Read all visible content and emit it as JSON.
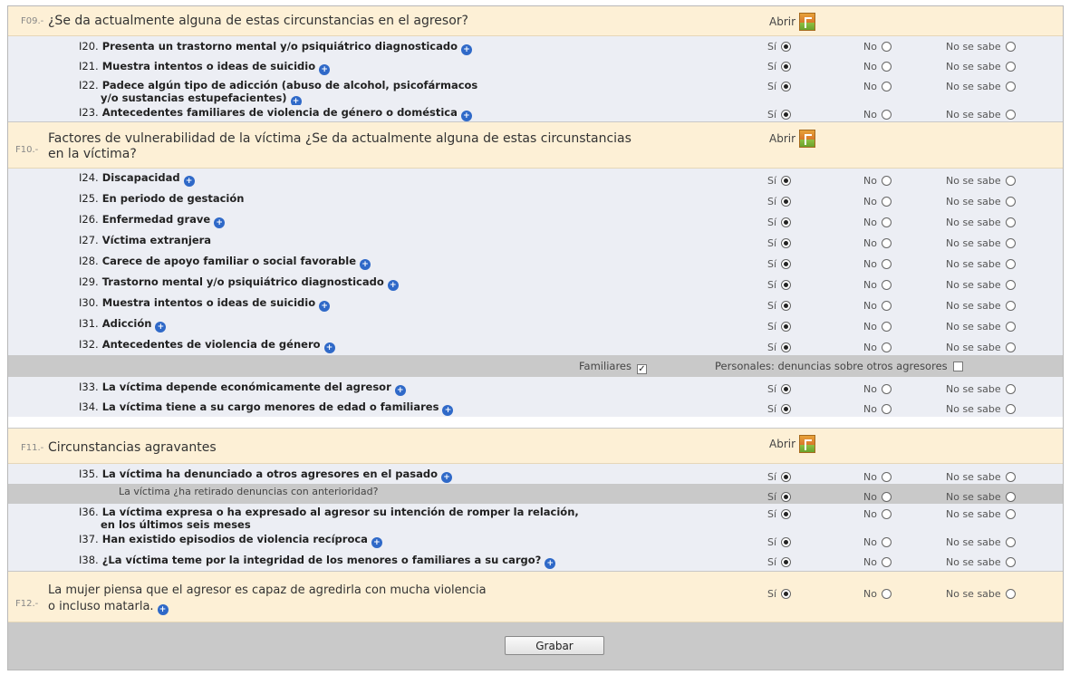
{
  "options": {
    "si": "Sí",
    "no": "No",
    "nose": "No se sabe"
  },
  "abrir": "Abrir",
  "sections": {
    "f09": {
      "code": "F09.-",
      "title": "¿Se da actualmente alguna de estas circunstancias en el agresor?",
      "items": [
        {
          "num": "I20.",
          "text": "Presenta un trastorno mental y/o psiquiátrico diagnosticado"
        },
        {
          "num": "I21.",
          "text": "Muestra intentos o ideas de suicidio"
        },
        {
          "num": "I22.",
          "text": "Padece algún tipo de adicción (abuso de alcohol, psicofármacos",
          "text2": "y/o sustancias estupefacientes)"
        },
        {
          "num": "I23.",
          "text": "Antecedentes familiares de violencia de género o doméstica"
        }
      ]
    },
    "f10": {
      "code": "F10.-",
      "title": "Factores de vulnerabilidad de la víctima ¿Se da actualmente alguna de estas circunstancias",
      "title2": "en la víctima?",
      "items": [
        {
          "num": "I24.",
          "text": "Discapacidad"
        },
        {
          "num": "I25.",
          "text": "En periodo de gestación"
        },
        {
          "num": "I26.",
          "text": "Enfermedad grave"
        },
        {
          "num": "I27.",
          "text": "Víctima extranjera"
        },
        {
          "num": "I28.",
          "text": "Carece de apoyo familiar o social favorable"
        },
        {
          "num": "I29.",
          "text": "Trastorno mental y/o psiquiátrico diagnosticado"
        },
        {
          "num": "I30.",
          "text": "Muestra intentos o ideas de suicidio"
        },
        {
          "num": "I31.",
          "text": "Adicción"
        },
        {
          "num": "I32.",
          "text": "Antecedentes de violencia de género"
        },
        {
          "num": "I33.",
          "text": "La víctima depende económicamente del agresor"
        },
        {
          "num": "I34.",
          "text": "La víctima tiene a su cargo menores de edad o familiares"
        }
      ],
      "familiares": "Familiares",
      "personales": "Personales: denuncias sobre otros agresores"
    },
    "f11": {
      "code": "F11.-",
      "title": "Circunstancias agravantes",
      "items": [
        {
          "num": "I35.",
          "text": "La víctima ha denunciado a otros agresores en el pasado"
        },
        {
          "sub": "La víctima ¿ha retirado denuncias con anterioridad?"
        },
        {
          "num": "I36.",
          "text": "La víctima expresa o ha expresado al agresor su intención de romper la relación,",
          "text2": "en los últimos seis meses"
        },
        {
          "num": "I37.",
          "text": "Han existido episodios de violencia recíproca"
        },
        {
          "num": "I38.",
          "text": "¿La víctima teme por la integridad de los menores o familiares a su cargo?"
        }
      ]
    },
    "f12": {
      "code": "F12.-",
      "title": "La mujer piensa que el agresor es capaz de agredirla con mucha violencia",
      "title2": "o incluso matarla."
    }
  },
  "save_label": "Grabar"
}
